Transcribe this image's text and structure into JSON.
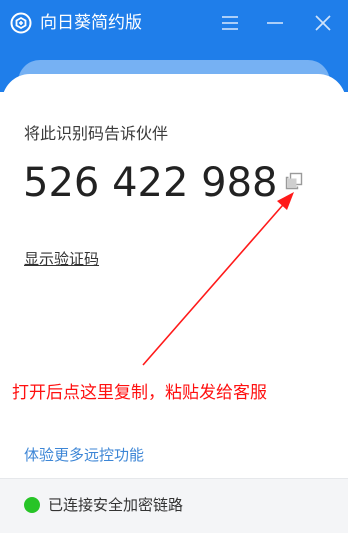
{
  "app": {
    "title": "向日葵简约版",
    "logo_icon": "sunlogin-logo-icon",
    "window_buttons": [
      "menu-icon",
      "minimize-icon",
      "close-icon"
    ]
  },
  "main": {
    "id_label": "将此识别码告诉伙伴",
    "id_number": "526 422 988",
    "copy_icon": "copy-icon",
    "show_code_link": "显示验证码",
    "more_features_link": "体验更多远控功能"
  },
  "annotation": {
    "text": "打开后点这里复制，粘贴发给客服",
    "color": "#ff1010"
  },
  "status": {
    "text": "已连接安全加密链路",
    "dot_color": "#27c427"
  },
  "colors": {
    "titlebar": "#1f7eea",
    "band": "#76b1f3",
    "link": "#3d86d6"
  }
}
